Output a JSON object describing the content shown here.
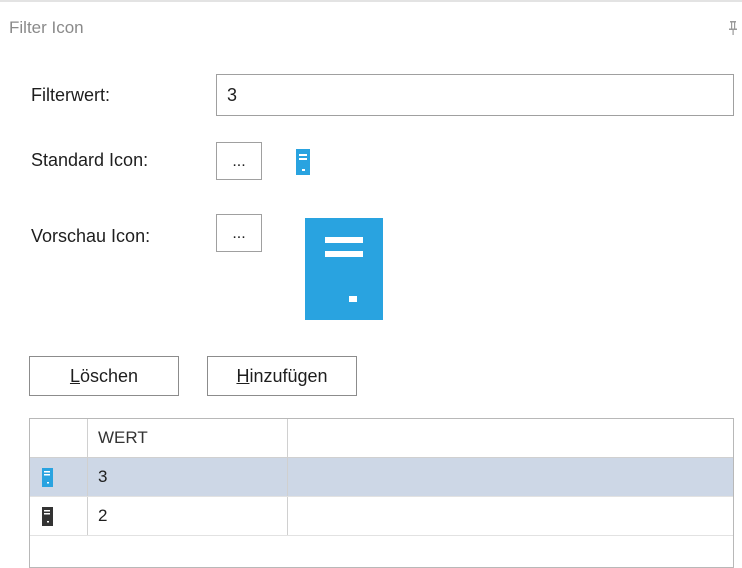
{
  "panel": {
    "title": "Filter Icon"
  },
  "form": {
    "filterwert_label": "Filterwert:",
    "filterwert_value": "3",
    "standard_icon_label": "Standard Icon:",
    "standard_icon_button": "...",
    "vorschau_icon_label": "Vorschau Icon:",
    "vorschau_icon_button": "..."
  },
  "buttons": {
    "loeschen_mnemonic": "L",
    "loeschen_rest": "öschen",
    "hinzufuegen_mnemonic": "H",
    "hinzufuegen_rest": "inzufügen"
  },
  "grid": {
    "columns": [
      "",
      "WERT",
      ""
    ],
    "rows": [
      {
        "icon": "server-blue-icon",
        "wert": "3",
        "selected": true
      },
      {
        "icon": "server-dark-icon",
        "wert": "2",
        "selected": false
      }
    ]
  },
  "colors": {
    "icon_blue": "#29a3e0",
    "icon_dark": "#333333",
    "selection": "#cdd7e6"
  }
}
